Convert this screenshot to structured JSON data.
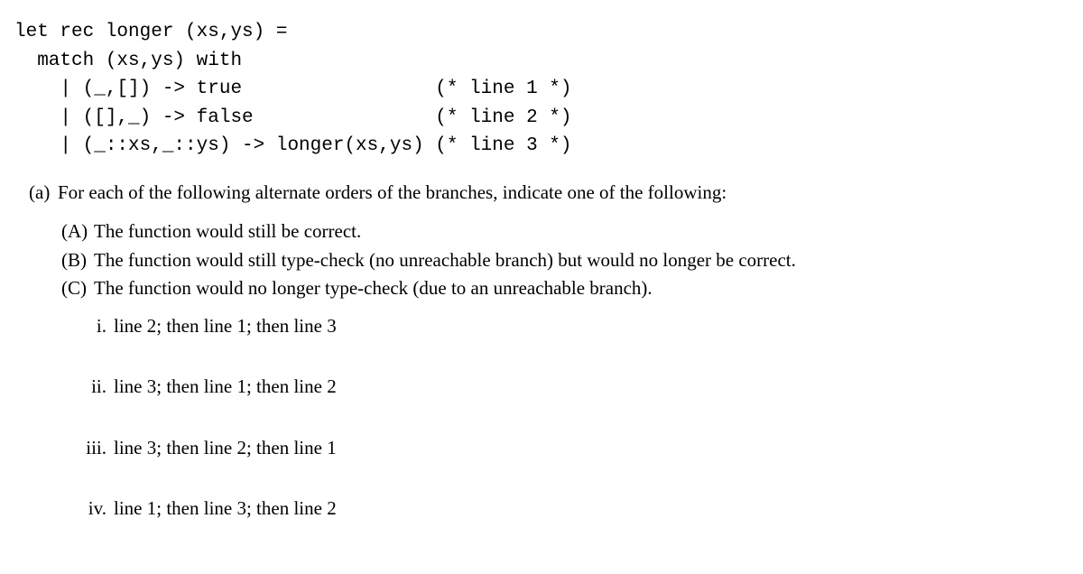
{
  "code": {
    "line1": "let rec longer (xs,ys) =",
    "line2": "  match (xs,ys) with",
    "line3": "    | (_,[]) -> true                 (* line 1 *)",
    "line4": "    | ([],_) -> false                (* line 2 *)",
    "line5": "    | (_::xs,_::ys) -> longer(xs,ys) (* line 3 *)"
  },
  "part_a": {
    "label": "(a)",
    "text": "For each of the following alternate orders of the branches, indicate one of the following:"
  },
  "options": {
    "A": {
      "label": "(A)",
      "text": "The function would still be correct."
    },
    "B": {
      "label": "(B)",
      "text": "The function would still type-check (no unreachable branch) but would no longer be correct."
    },
    "C": {
      "label": "(C)",
      "text": "The function would no longer type-check (due to an unreachable branch)."
    }
  },
  "subs": {
    "i": {
      "label": "i.",
      "text": "line 2; then line 1; then line 3"
    },
    "ii": {
      "label": "ii.",
      "text": "line 3; then line 1; then line 2"
    },
    "iii": {
      "label": "iii.",
      "text": "line 3; then line 2; then line 1"
    },
    "iv": {
      "label": "iv.",
      "text": "line 1; then line 3; then line 2"
    }
  }
}
